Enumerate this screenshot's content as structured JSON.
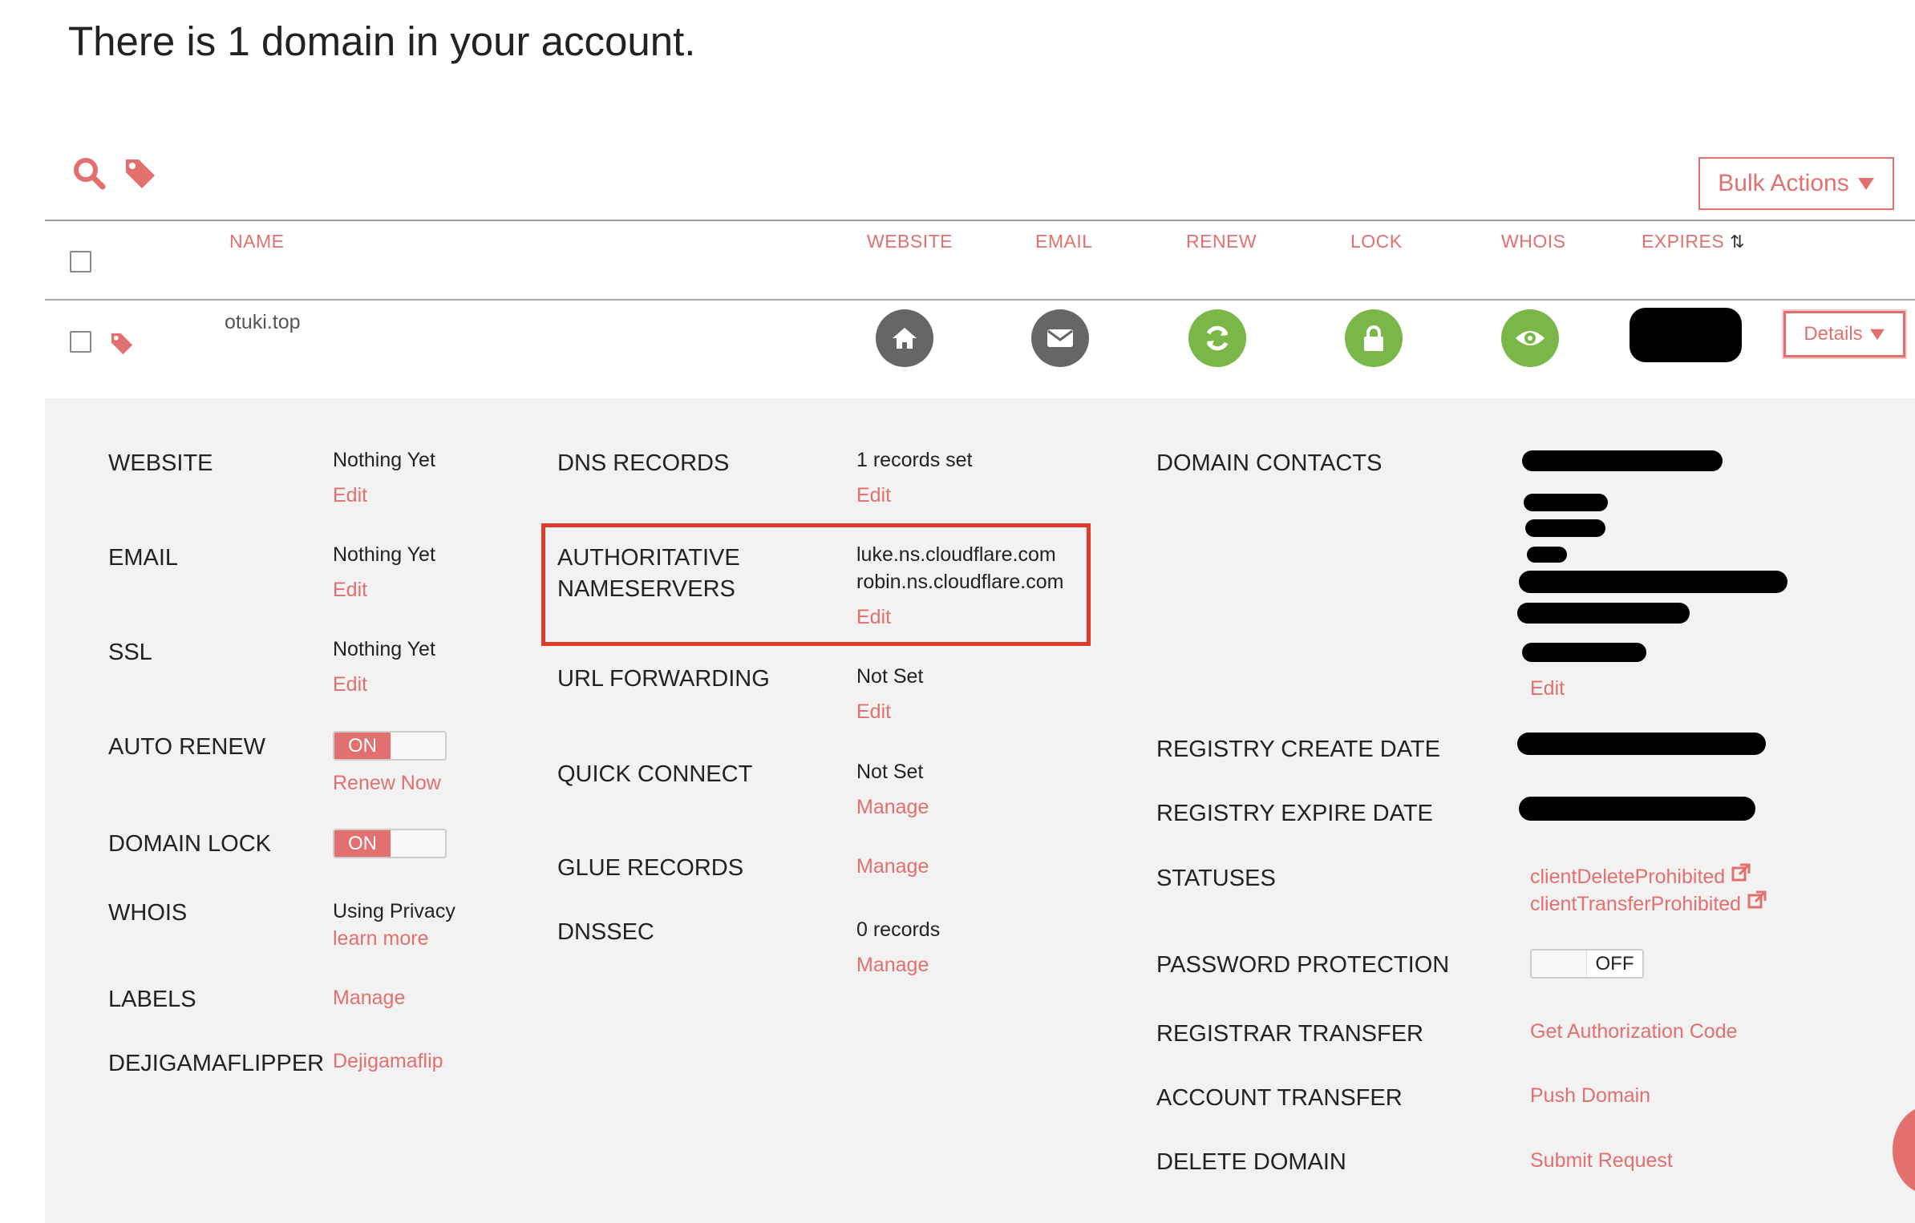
{
  "page_title": "There is 1 domain in your account.",
  "toolbar": {
    "search_icon": "search-icon",
    "tag_icon": "tag-icon",
    "bulk_actions_label": "Bulk Actions"
  },
  "columns": {
    "name": "NAME",
    "website": "WEBSITE",
    "email": "EMAIL",
    "renew": "RENEW",
    "lock": "LOCK",
    "whois": "WHOIS",
    "expires": "EXPIRES"
  },
  "domain_row": {
    "name": "otuki.top",
    "details_label": "Details",
    "icons": [
      "home-icon",
      "envelope-icon",
      "refresh-icon",
      "lock-icon",
      "eye-icon"
    ]
  },
  "colors": {
    "accent": "#e2706f",
    "green": "#7ab648",
    "gray": "#666666",
    "panel_bg": "#f2f2f2",
    "highlight": "#e03a2a"
  },
  "details": {
    "col1": {
      "website": {
        "label": "WEBSITE",
        "value": "Nothing Yet",
        "action": "Edit"
      },
      "email": {
        "label": "EMAIL",
        "value": "Nothing Yet",
        "action": "Edit"
      },
      "ssl": {
        "label": "SSL",
        "value": "Nothing Yet",
        "action": "Edit"
      },
      "auto_renew": {
        "label": "AUTO RENEW",
        "toggle": "ON",
        "action": "Renew Now"
      },
      "domain_lock": {
        "label": "DOMAIN LOCK",
        "toggle": "ON"
      },
      "whois": {
        "label": "WHOIS",
        "value": "Using Privacy",
        "action": "learn more"
      },
      "labels": {
        "label": "LABELS",
        "action": "Manage"
      },
      "dejigamaflipper": {
        "label": "DEJIGAMAFLIPPER",
        "action": "Dejigamaflip"
      }
    },
    "col2": {
      "dns_records": {
        "label": "DNS RECORDS",
        "value": "1 records set",
        "action": "Edit"
      },
      "nameservers": {
        "label_line1": "AUTHORITATIVE",
        "label_line2": "NAMESERVERS",
        "ns1": "luke.ns.cloudflare.com",
        "ns2": "robin.ns.cloudflare.com",
        "action": "Edit"
      },
      "url_forwarding": {
        "label": "URL FORWARDING",
        "value": "Not Set",
        "action": "Edit"
      },
      "quick_connect": {
        "label": "QUICK CONNECT",
        "value": "Not Set",
        "action": "Manage"
      },
      "glue_records": {
        "label": "GLUE RECORDS",
        "action": "Manage"
      },
      "dnssec": {
        "label": "DNSSEC",
        "value": "0 records",
        "action": "Manage"
      }
    },
    "col3": {
      "domain_contacts": {
        "label": "DOMAIN CONTACTS",
        "action": "Edit"
      },
      "registry_create": {
        "label": "REGISTRY CREATE DATE"
      },
      "registry_expire": {
        "label": "REGISTRY EXPIRE DATE"
      },
      "statuses": {
        "label": "STATUSES",
        "items": [
          "clientDeleteProhibited",
          "clientTransferProhibited"
        ]
      },
      "password_protection": {
        "label": "PASSWORD PROTECTION",
        "toggle": "OFF"
      },
      "registrar_transfer": {
        "label": "REGISTRAR TRANSFER",
        "action": "Get Authorization Code"
      },
      "account_transfer": {
        "label": "ACCOUNT TRANSFER",
        "action": "Push Domain"
      },
      "delete_domain": {
        "label": "DELETE DOMAIN",
        "action": "Submit Request"
      }
    }
  }
}
